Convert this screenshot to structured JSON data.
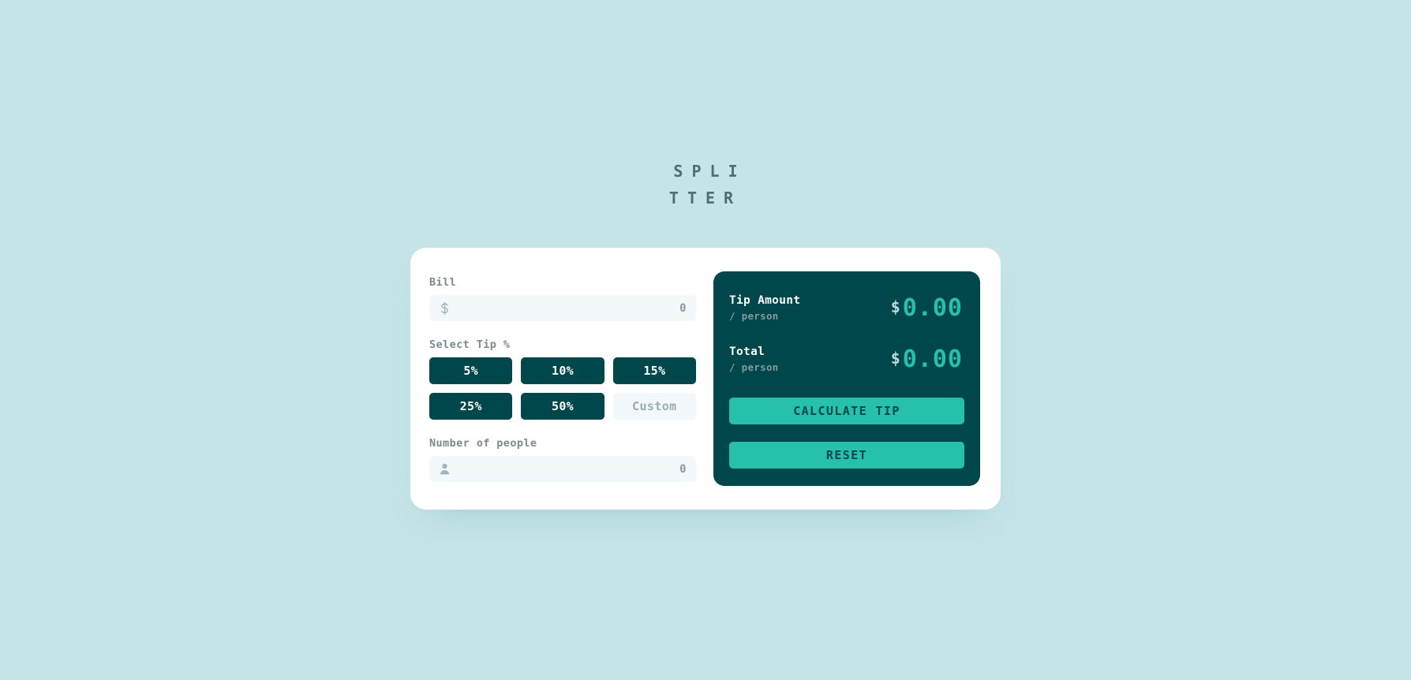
{
  "app": {
    "title": "SPLITTER"
  },
  "bill": {
    "label": "Bill",
    "currency_icon": "dollar-sign-icon",
    "currency_symbol": "$",
    "value": "0",
    "placeholder": "0"
  },
  "tip": {
    "label": "Select Tip %",
    "options": [
      {
        "label": "5%",
        "selected": false
      },
      {
        "label": "10%",
        "selected": false
      },
      {
        "label": "15%",
        "selected": false
      },
      {
        "label": "25%",
        "selected": false
      },
      {
        "label": "50%",
        "selected": false
      }
    ],
    "custom": {
      "placeholder": "Custom",
      "value": ""
    }
  },
  "people": {
    "label": "Number of people",
    "person_icon": "person-icon",
    "value": "0",
    "placeholder": "0"
  },
  "results": {
    "rows": [
      {
        "title": "Tip Amount",
        "subtitle": "/ person",
        "currency": "$",
        "amount": "0.00"
      },
      {
        "title": "Total",
        "subtitle": "/ person",
        "currency": "$",
        "amount": "0.00"
      }
    ],
    "calculate_label": "CALCULATE TIP",
    "reset_label": "RESET"
  },
  "colors": {
    "background": "#c5e4e7",
    "card": "#ffffff",
    "dark_teal": "#00474b",
    "bright_teal": "#26c0ab",
    "input_bg": "#f3f8fb",
    "label_gray": "#7b8b8d",
    "title_gray": "#4e6e70"
  }
}
